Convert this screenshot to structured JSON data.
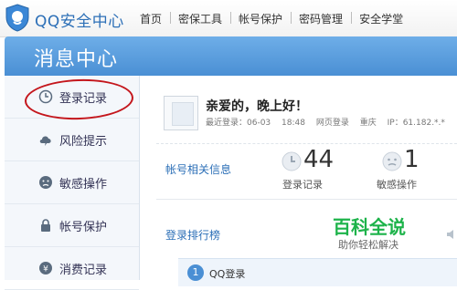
{
  "header": {
    "logo_text": "QQ安全中心",
    "nav": [
      "首页",
      "密保工具",
      "帐号保护",
      "密码管理",
      "安全学堂"
    ]
  },
  "banner": {
    "title": "消息中心"
  },
  "sidebar": {
    "items": [
      {
        "label": "登录记录",
        "icon": "clock-icon"
      },
      {
        "label": "风险提示",
        "icon": "cloud-icon"
      },
      {
        "label": "敏感操作",
        "icon": "face-icon"
      },
      {
        "label": "帐号保护",
        "icon": "lock-icon"
      },
      {
        "label": "消费记录",
        "icon": "coin-icon"
      }
    ]
  },
  "profile": {
    "greeting": "亲爱的，晚上好！",
    "last_login_label": "最近登录：06-03",
    "last_login_time": "18:48",
    "login_method": "网页登录",
    "location": "重庆",
    "ip": "IP：61.182.*.*"
  },
  "account_info": {
    "title": "帐号相关信息",
    "login_count": "44",
    "login_label": "登录记录",
    "sensitive_count": "1",
    "sensitive_label": "敏感操作"
  },
  "ranking": {
    "title": "登录排行榜",
    "first_rank": "1",
    "first_label": "QQ登录"
  },
  "watermark": {
    "title": "百科全说",
    "subtitle": "助你轻松解决"
  },
  "colors": {
    "accent": "#4a8fd4",
    "link": "#2c6fb7",
    "highlight": "#c4161c",
    "watermark": "#1db34a"
  }
}
